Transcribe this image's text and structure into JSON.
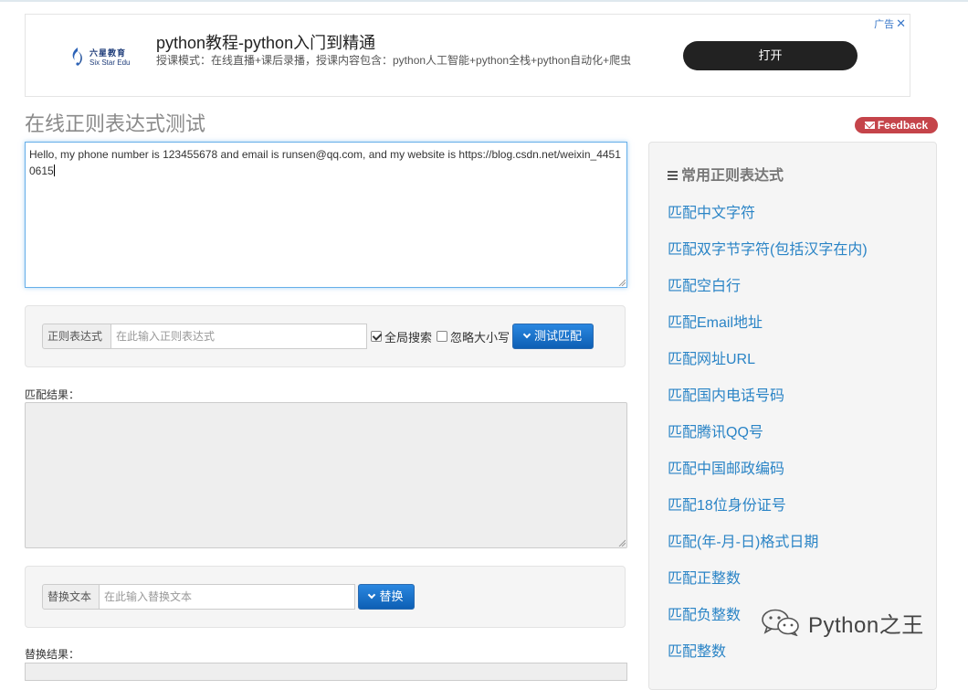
{
  "ad": {
    "logo_cn": "六星教育",
    "logo_en": "Six Star Edu",
    "title": "python教程-python入门到精通",
    "description": "授课模式：在线直播+课后录播，授课内容包含：python人工智能+python全栈+python自动化+爬虫",
    "open_button": "打开",
    "ad_label": "广告"
  },
  "page": {
    "title": "在线正则表达式测试",
    "feedback": "Feedback"
  },
  "input": {
    "text": "Hello, my phone number is 123455678 and email is runsen@qq.com, and my website is https://blog.csdn.net/weixin_44510615"
  },
  "regex": {
    "addon": "正则表达式",
    "placeholder": "在此输入正则表达式",
    "global_label": "全局搜索",
    "global_checked": true,
    "ignorecase_label": "忽略大小写",
    "ignorecase_checked": false,
    "test_button": "测试匹配"
  },
  "match_result_label": "匹配结果：",
  "replace": {
    "addon": "替换文本",
    "placeholder": "在此输入替换文本",
    "button": "替换"
  },
  "replace_result_label": "替换结果：",
  "sidebar": {
    "title": "常用正则表达式",
    "links": [
      "匹配中文字符",
      "匹配双字节字符(包括汉字在内)",
      "匹配空白行",
      "匹配Email地址",
      "匹配网址URL",
      "匹配国内电话号码",
      "匹配腾讯QQ号",
      "匹配中国邮政编码",
      "匹配18位身份证号",
      "匹配(年-月-日)格式日期",
      "匹配正整数",
      "匹配负整数",
      "匹配整数"
    ]
  },
  "watermark": "Python之王",
  "colors": {
    "accent_blue": "#1a73c9",
    "link": "#2a84c6",
    "feedback_red": "#c5444a"
  }
}
